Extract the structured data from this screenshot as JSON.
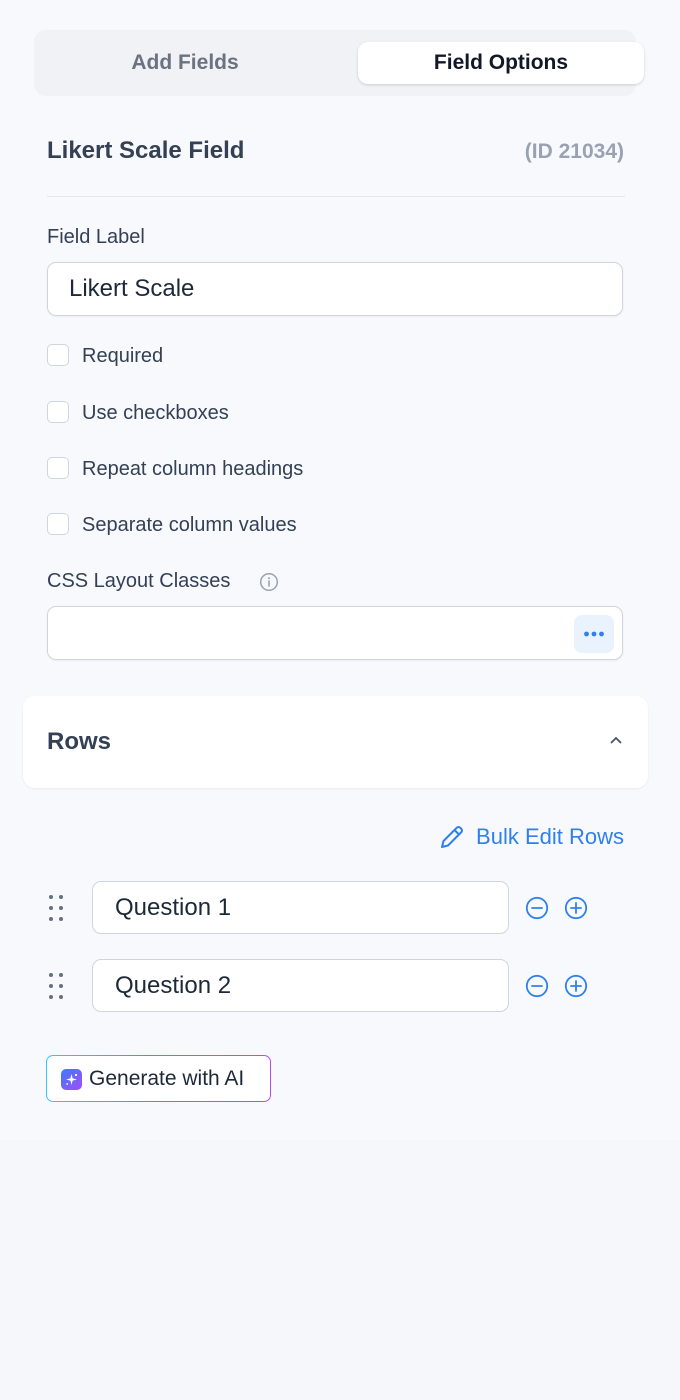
{
  "tabs": {
    "add_fields": "Add Fields",
    "field_options": "Field Options"
  },
  "header": {
    "title": "Likert Scale Field",
    "id": "(ID 21034)"
  },
  "field_label": {
    "label": "Field Label",
    "value": "Likert Scale"
  },
  "options": [
    {
      "label": "Required",
      "checked": false
    },
    {
      "label": "Use checkboxes",
      "checked": false
    },
    {
      "label": "Repeat column headings",
      "checked": false
    },
    {
      "label": "Separate column values",
      "checked": false
    }
  ],
  "css_classes": {
    "label": "CSS Layout Classes",
    "value": ""
  },
  "rows_section": {
    "title": "Rows",
    "bulk_edit_label": "Bulk Edit Rows",
    "rows": [
      {
        "value": "Question 1"
      },
      {
        "value": "Question 2"
      }
    ]
  },
  "ai_button": {
    "label": "Generate with AI"
  },
  "colors": {
    "accent": "#2f80ed",
    "text_primary": "#344054",
    "muted": "#98a2b3"
  }
}
